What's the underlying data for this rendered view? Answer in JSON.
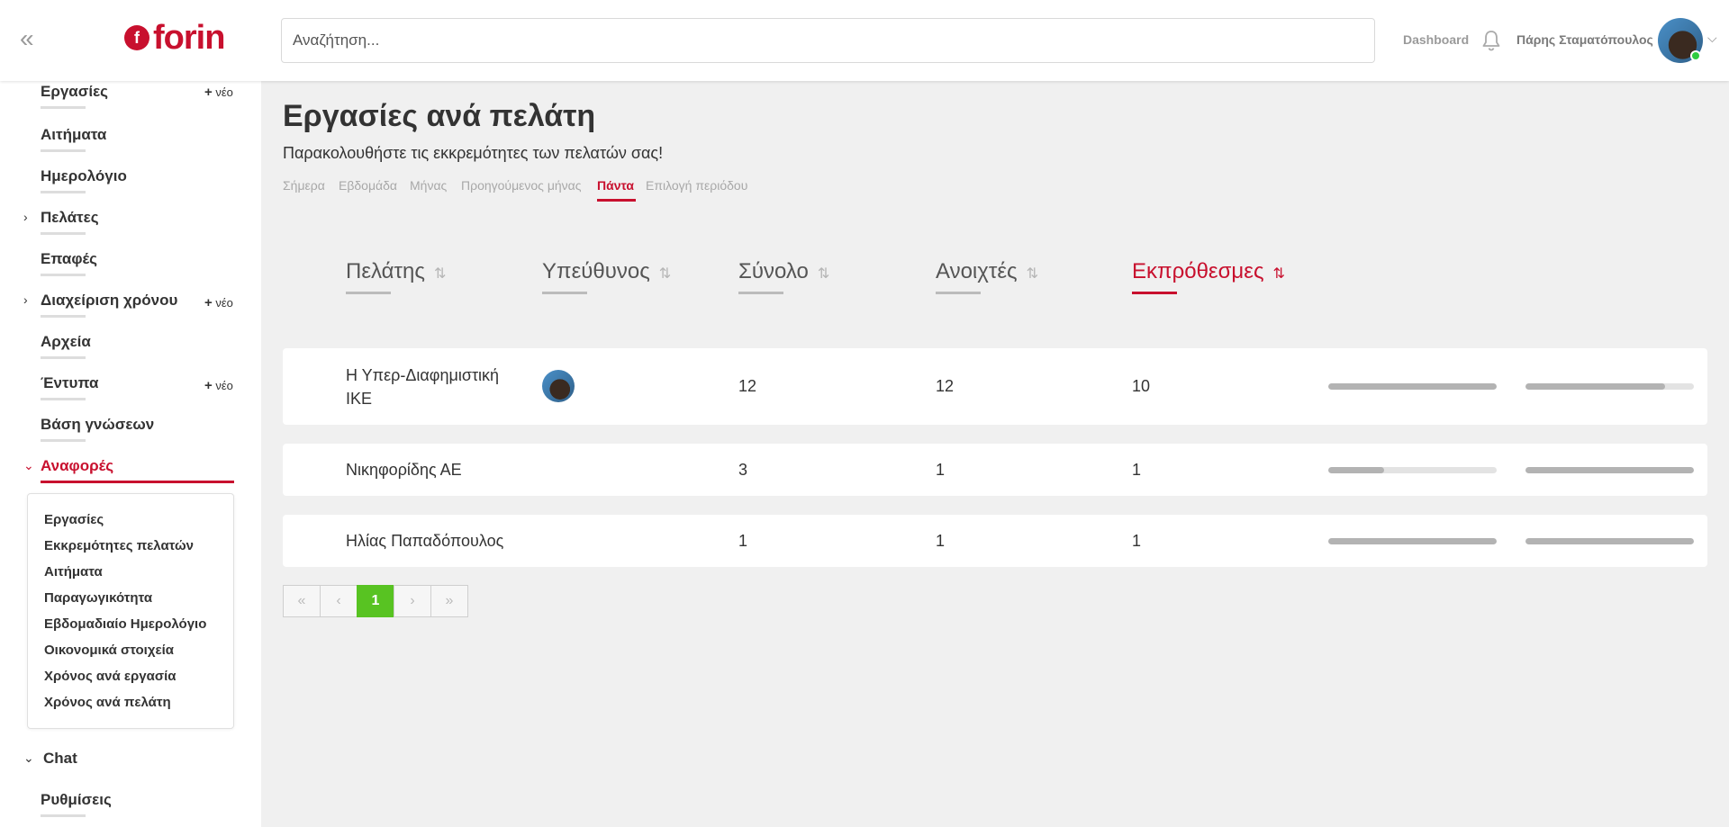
{
  "header": {
    "logo_text": "forin",
    "logo_mark": "f",
    "search_placeholder": "Αναζήτηση...",
    "dashboard_label": "Dashboard",
    "user_name": "Πάρης Σταματόπουλος",
    "collapse_glyph": "«",
    "caret_glyph": "⌵"
  },
  "sidebar": {
    "new_label": "νέο",
    "items": [
      {
        "label": "Εργασίες"
      },
      {
        "label": "Αιτήματα"
      },
      {
        "label": "Ημερολόγιο"
      },
      {
        "label": "Πελάτες"
      },
      {
        "label": "Επαφές"
      },
      {
        "label": "Διαχείριση χρόνου"
      },
      {
        "label": "Αρχεία"
      },
      {
        "label": "Έντυπα"
      },
      {
        "label": "Βάση γνώσεων"
      },
      {
        "label": "Αναφορές"
      },
      {
        "label": "Chat"
      },
      {
        "label": "Ρυθμίσεις"
      }
    ],
    "reports_submenu": [
      "Εργασίες",
      "Εκκρεμότητες πελατών",
      "Αιτήματα",
      "Παραγωγικότητα",
      "Εβδομαδιαίο Ημερολόγιο",
      "Οικονομικά στοιχεία",
      "Χρόνος ανά εργασία",
      "Χρόνος ανά πελάτη"
    ]
  },
  "main": {
    "title": "Εργασίες ανά πελάτη",
    "subtitle": "Παρακολουθήστε τις εκκρεμότητες των πελατών σας!",
    "periods": [
      "Σήμερα",
      "Εβδομάδα",
      "Μήνας",
      "Προηγούμενος μήνας",
      "Πάντα",
      "Επιλογή περιόδου"
    ],
    "active_period": "Πάντα",
    "columns": [
      "Πελάτης",
      "Υπεύθυνος",
      "Σύνολο",
      "Ανοιχτές",
      "Εκπρόθεσμες"
    ],
    "sorted_column": "Εκπρόθεσμες",
    "rows": [
      {
        "client_line1": "Η Υπερ-Διαφημιστική",
        "client_line2": "ΙΚΕ",
        "has_owner": true,
        "total": "12",
        "open": "12",
        "overdue": "10",
        "bar1": 1.0,
        "bar2": 0.83
      },
      {
        "client_line1": "Νικηφορίδης ΑΕ",
        "client_line2": "",
        "has_owner": false,
        "total": "3",
        "open": "1",
        "overdue": "1",
        "bar1": 0.33,
        "bar2": 1.0
      },
      {
        "client_line1": "Ηλίας Παπαδόπουλος",
        "client_line2": "",
        "has_owner": false,
        "total": "1",
        "open": "1",
        "overdue": "1",
        "bar1": 1.0,
        "bar2": 1.0
      }
    ],
    "pagination": {
      "first": "«",
      "prev": "‹",
      "current": "1",
      "next": "›",
      "last": "»"
    }
  },
  "colors": {
    "accent": "#c8102e",
    "pager_active": "#58c322",
    "online": "#2ecc40"
  }
}
